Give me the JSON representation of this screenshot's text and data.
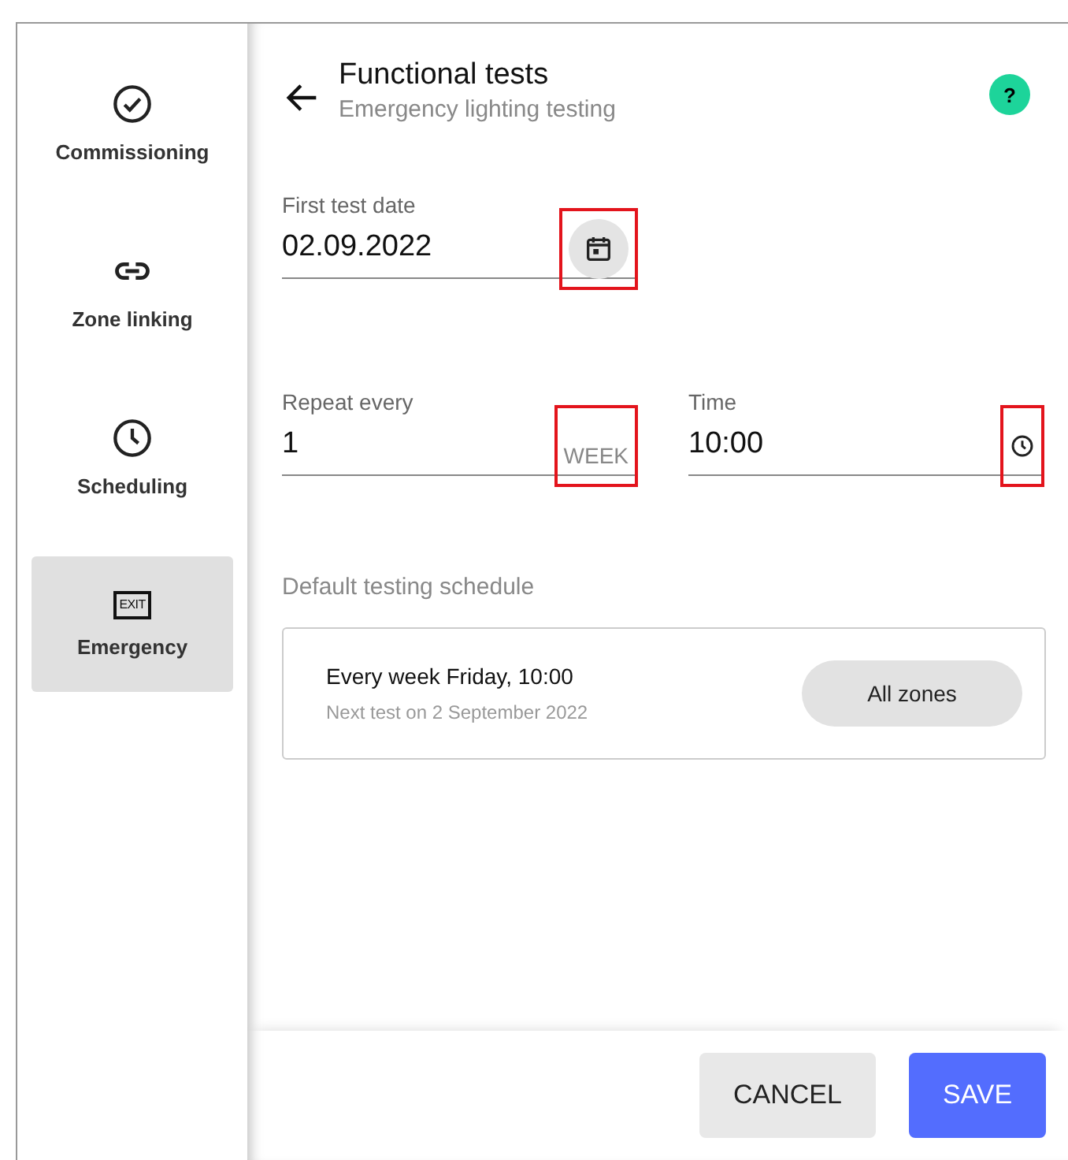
{
  "sidebar": {
    "items": [
      {
        "label": "Commissioning",
        "kind": "check",
        "selected": false
      },
      {
        "label": "Zone linking",
        "kind": "link",
        "selected": false
      },
      {
        "label": "Scheduling",
        "kind": "clock",
        "selected": false
      },
      {
        "label": "Emergency",
        "kind": "exit",
        "icon_text": "EXIT",
        "selected": true
      }
    ]
  },
  "header": {
    "title": "Functional tests",
    "subtitle": "Emergency lighting testing",
    "help": "?"
  },
  "first_test_date": {
    "label": "First test date",
    "value": "02.09.2022",
    "highlighted": true
  },
  "repeat_every": {
    "label": "Repeat every",
    "value": "1",
    "unit": "WEEK",
    "highlighted": true
  },
  "time": {
    "label": "Time",
    "value": "10:00",
    "highlighted": true
  },
  "schedule": {
    "heading": "Default testing schedule",
    "summary": "Every week Friday, 10:00",
    "next_test": "Next test on 2 September 2022",
    "zones": "All zones"
  },
  "buttons": {
    "cancel": "CANCEL",
    "save": "SAVE"
  }
}
